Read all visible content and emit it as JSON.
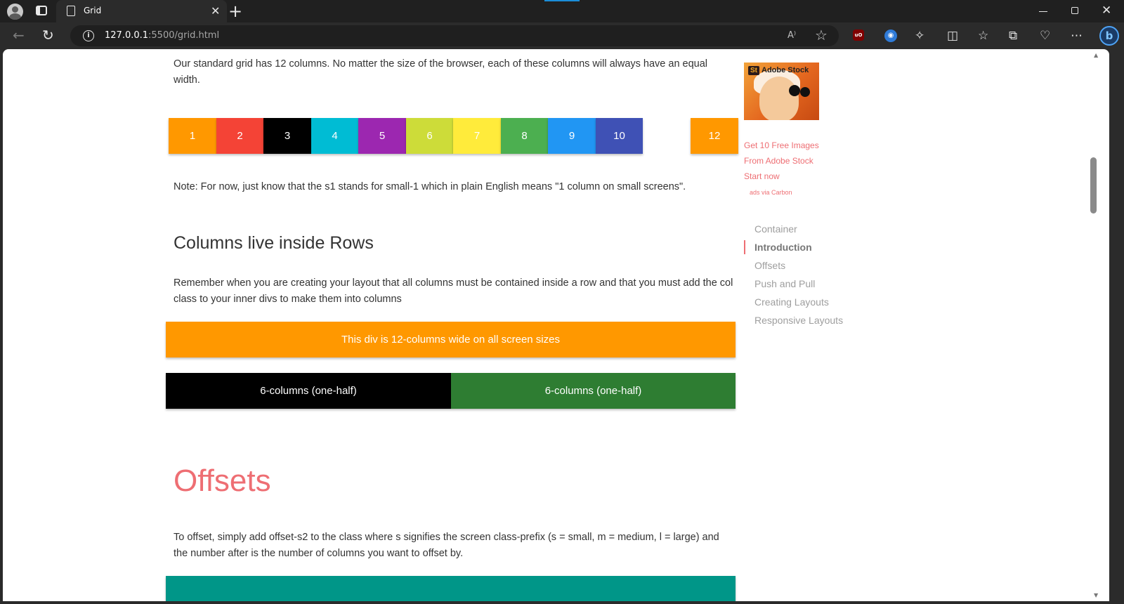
{
  "browser": {
    "tab_title": "Grid",
    "tab_close": "✕",
    "new_tab": "+",
    "url_host": "127.0.0.1",
    "url_rest": ":5500/grid.html",
    "window_min": "",
    "window_close": "✕",
    "read_aloud": "A⁾",
    "ublock_label": "uO"
  },
  "page": {
    "intro_text": "Our standard grid has 12 columns. No matter the size of the browser, each of these columns will always have an equal width.",
    "grid_columns": [
      {
        "label": "1",
        "color": "#ff9800"
      },
      {
        "label": "2",
        "color": "#f44336"
      },
      {
        "label": "3",
        "color": "#000000"
      },
      {
        "label": "4",
        "color": "#00bcd4"
      },
      {
        "label": "5",
        "color": "#9c27b0"
      },
      {
        "label": "6",
        "color": "#cddc39"
      },
      {
        "label": "7",
        "color": "#ffeb3b"
      },
      {
        "label": "8",
        "color": "#4caf50"
      },
      {
        "label": "9",
        "color": "#2196f3"
      },
      {
        "label": "10",
        "color": "#3f51b5"
      },
      {
        "label": "",
        "color": "#ffffff"
      },
      {
        "label": "12",
        "color": "#ff9800"
      }
    ],
    "note_text": "Note: For now, just know that the s1 stands for small-1 which in plain English means \"1 column on small screens\".",
    "rows_heading": "Columns live inside Rows",
    "rows_text": "Remember when you are creating your layout that all columns must be contained inside a row and that you must add the col class to your inner divs to make them into columns",
    "full_width_label": "This div is 12-columns wide on all screen sizes",
    "half_left_label": "6-columns (one-half)",
    "half_right_label": "6-columns (one-half)",
    "offsets_heading": "Offsets",
    "offsets_text": "To offset, simply add offset-s2 to the class where s signifies the screen class-prefix (s = small, m = medium, l = large) and the number after is the number of columns you want to offset by.",
    "colors": {
      "orange": "#ff9800",
      "black": "#000000",
      "green_dark": "#2e7d32",
      "teal": "#009688",
      "accent": "#ee6e73"
    }
  },
  "sidebar": {
    "ad_brand": "Adobe Stock",
    "ad_badge": "St",
    "ad_lines": [
      "Get 10 Free Images",
      "From Adobe Stock",
      "Start now"
    ],
    "ad_via": "ads via Carbon",
    "toc": [
      {
        "label": "Container",
        "active": false
      },
      {
        "label": "Introduction",
        "active": true
      },
      {
        "label": "Offsets",
        "active": false
      },
      {
        "label": "Push and Pull",
        "active": false
      },
      {
        "label": "Creating Layouts",
        "active": false
      },
      {
        "label": "Responsive Layouts",
        "active": false
      }
    ]
  }
}
